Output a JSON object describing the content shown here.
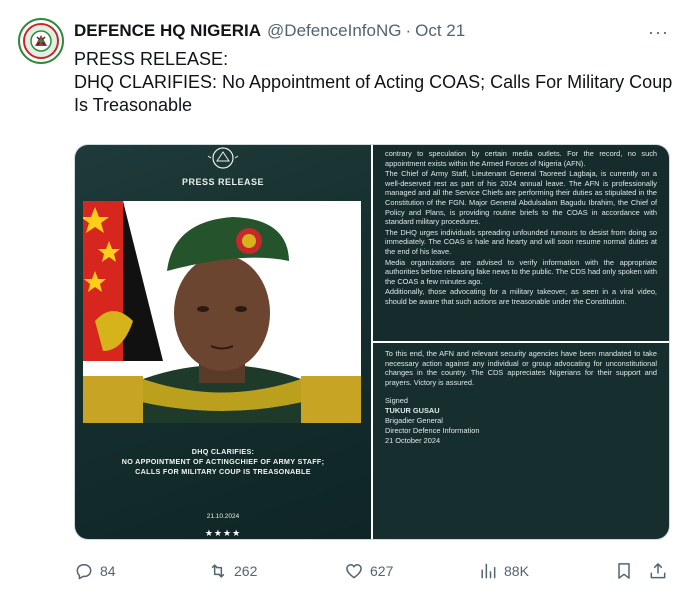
{
  "tweet": {
    "author_name": "DEFENCE HQ NIGERIA",
    "handle": "@DefenceInfoNG",
    "separator": "·",
    "date": "Oct 21",
    "more_label": "···",
    "text_line1": "PRESS RELEASE:",
    "text_line2": "DHQ CLARIFIES:  No Appointment of Acting COAS; Calls For Military Coup Is Treasonable"
  },
  "media": {
    "left": {
      "header": "PRESS RELEASE",
      "caption_line1": "DHQ CLARIFIES:",
      "caption_line2": "NO APPOINTMENT OF ACTINGCHIEF OF ARMY STAFF;",
      "caption_line3": "CALLS FOR MILITARY COUP IS TREASONABLE",
      "date": "21.10.2024",
      "stars": "★★★★"
    },
    "right": {
      "paragraphs": [
        "contrary to speculation by certain media outlets. For the record, no such appointment exists within the Armed Forces of Nigeria (AFN).",
        "The Chief of Army Staff, Lieutenant General Taoreed Lagbaja, is currently on a well-deserved rest as part of his 2024 annual leave. The AFN is professionally managed and all the Service Chiefs are performing their duties as stipulated in the Constitution of the FGN. Major General Abdulsalam Bagudu Ibrahim, the Chief of Policy and Plans, is providing routine briefs to the COAS in accordance with standard military procedures.",
        "The DHQ urges individuals spreading unfounded rumours to desist from doing so immediately. The COAS is hale and hearty and will soon resume normal duties at the end of his leave.",
        "Media organizations are advised to verify information with the appropriate authorities before releasing fake news to the public. The CDS had only spoken with the COAS a few minutes ago.",
        "Additionally, those advocating for a military takeover, as seen in a viral video, should be aware that such actions are treasonable under the Constitution."
      ],
      "paragraphs_bottom": [
        "To this end, the AFN and relevant security agencies have been mandated to take necessary action against any individual or group advocating for unconstitutional changes in the country. The CDS appreciates Nigerians for their support and prayers. Victory is assured."
      ],
      "signed_label": "Signed",
      "signer_name": "TUKUR GUSAU",
      "signer_rank": "Brigadier General",
      "signer_title": "Director Defence Information",
      "signed_date": "21 October 2024"
    }
  },
  "actions": {
    "replies": "84",
    "reposts": "262",
    "likes": "627",
    "views": "88K"
  },
  "colors": {
    "accent_text": "#0f1419",
    "muted_text": "#536471",
    "panel_bg": "#16302f"
  }
}
